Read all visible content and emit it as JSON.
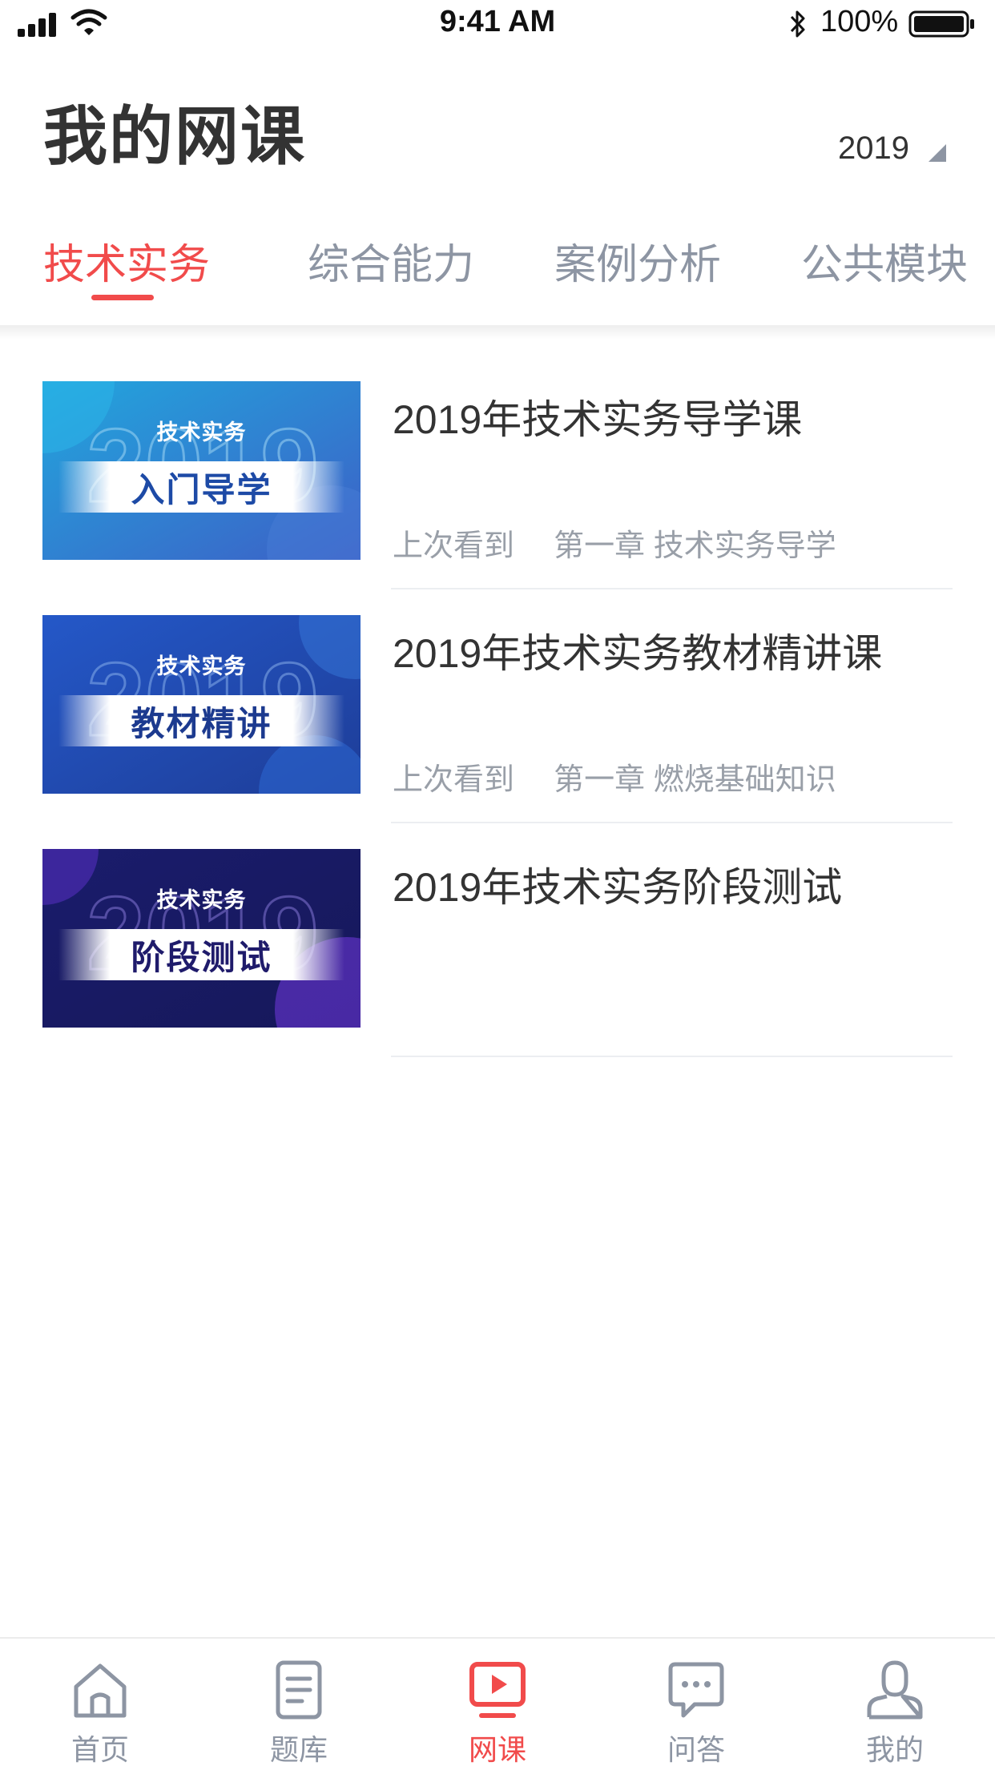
{
  "status_bar": {
    "time": "9:41 AM",
    "battery_text": "100%",
    "icons": [
      "signal-icon",
      "wifi-icon",
      "bluetooth-icon",
      "battery-icon"
    ]
  },
  "header": {
    "title": "我的网课",
    "year": "2019"
  },
  "tabs": [
    {
      "label": "技术实务",
      "active": true
    },
    {
      "label": "综合能力",
      "active": false
    },
    {
      "label": "案例分析",
      "active": false
    },
    {
      "label": "公共模块",
      "active": false
    }
  ],
  "courses": [
    {
      "title": "2019年技术实务导学课",
      "meta_prefix": "上次看到",
      "meta_chapter": "第一章 技术实务导学",
      "thumb_small": "技术实务",
      "thumb_big": "入门导学",
      "thumb_colors": [
        "#1e9fd8",
        "#3566c8"
      ],
      "thumb_text_color": "#1d4aa6"
    },
    {
      "title": "2019年技术实务教材精讲课",
      "meta_prefix": "上次看到",
      "meta_chapter": "第一章 燃烧基础知识",
      "thumb_small": "技术实务",
      "thumb_big": "教材精讲",
      "thumb_colors": [
        "#2153c2",
        "#1c3f9e"
      ],
      "thumb_text_color": "#1c3a8f"
    },
    {
      "title": "2019年技术实务阶段测试",
      "meta_prefix": "",
      "meta_chapter": "",
      "thumb_small": "技术实务",
      "thumb_big": "阶段测试",
      "thumb_colors": [
        "#1b1d6e",
        "#5a2bc9"
      ],
      "thumb_text_color": "#1f1b6b"
    }
  ],
  "bottom_nav": [
    {
      "label": "首页",
      "icon": "home-icon",
      "active": false
    },
    {
      "label": "题库",
      "icon": "question-bank-icon",
      "active": false
    },
    {
      "label": "网课",
      "icon": "video-course-icon",
      "active": true
    },
    {
      "label": "问答",
      "icon": "chat-icon",
      "active": false
    },
    {
      "label": "我的",
      "icon": "profile-icon",
      "active": false
    }
  ],
  "colors": {
    "accent": "#f14b4b",
    "inactive": "#8d95a3",
    "text": "#333333",
    "meta": "#999fa8"
  }
}
